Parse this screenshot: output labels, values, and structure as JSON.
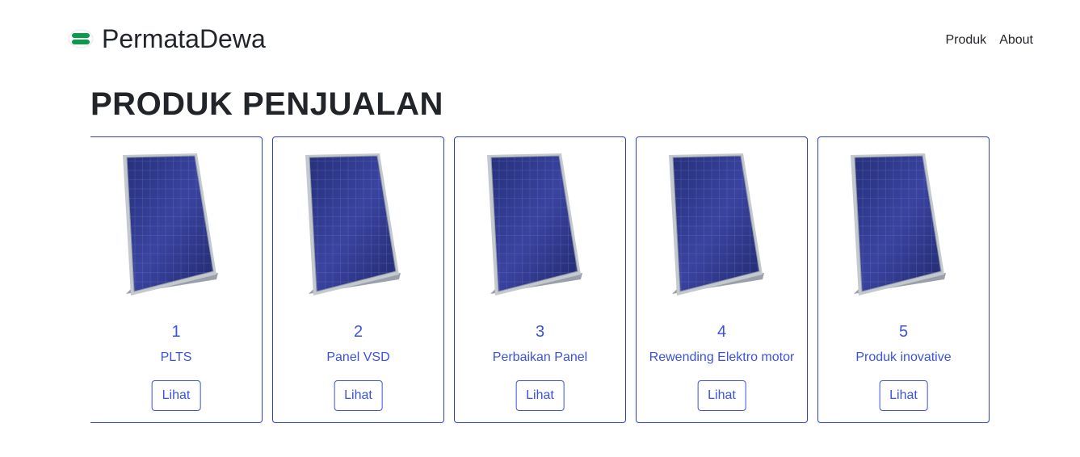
{
  "navbar": {
    "brand_name": "PermataDewa",
    "logo_icon": "green-capsule-logo",
    "links": [
      {
        "label": "Produk"
      },
      {
        "label": "About"
      }
    ]
  },
  "main": {
    "title": "PRODUK PENJUALAN",
    "products": [
      {
        "number": "1",
        "name": "PLTS",
        "button_label": "Lihat",
        "image": "solar-panel-image"
      },
      {
        "number": "2",
        "name": "Panel VSD",
        "button_label": "Lihat",
        "image": "solar-panel-image"
      },
      {
        "number": "3",
        "name": "Perbaikan Panel",
        "button_label": "Lihat",
        "image": "solar-panel-image"
      },
      {
        "number": "4",
        "name": "Rewending Elektro motor",
        "button_label": "Lihat",
        "image": "solar-panel-image"
      },
      {
        "number": "5",
        "name": "Produk inovative",
        "button_label": "Lihat",
        "image": "solar-panel-image"
      }
    ]
  },
  "colors": {
    "accent": "#3b52e0",
    "card_border": "#2b3fd3",
    "logo_green": "#0a9c4a",
    "text": "#212529"
  }
}
